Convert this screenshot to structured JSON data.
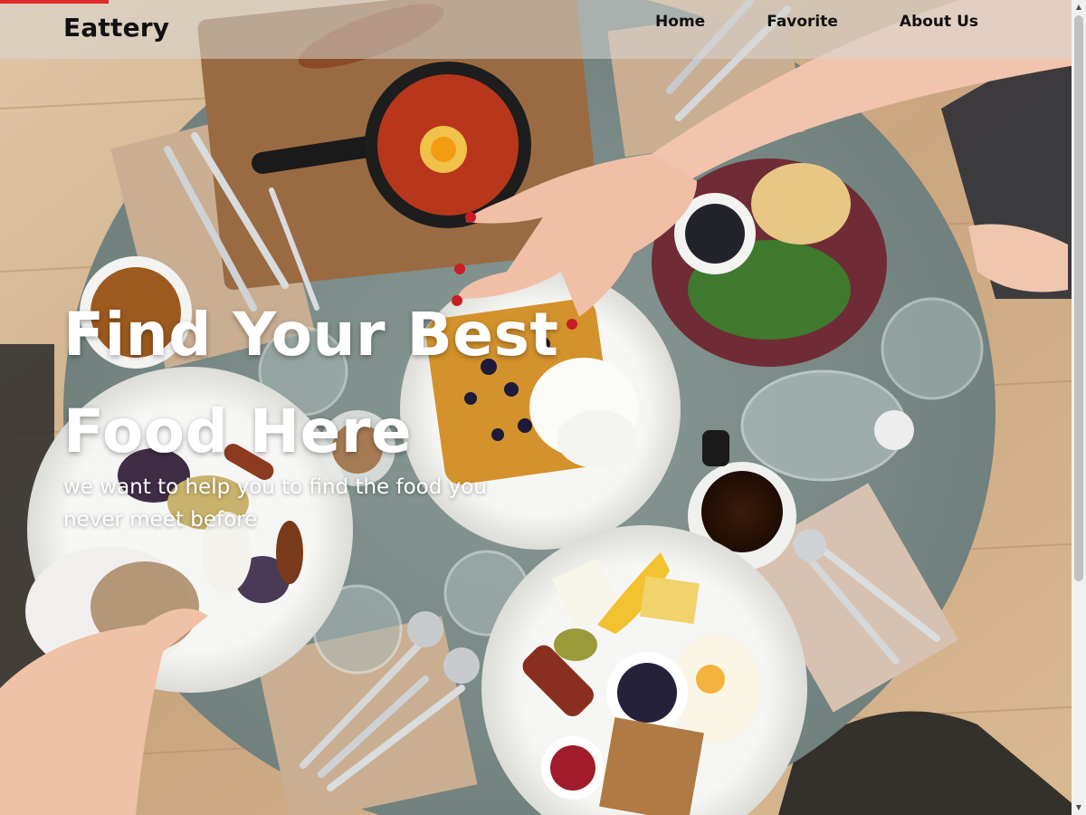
{
  "navbar": {
    "brand": "Eattery",
    "links": [
      "Home",
      "Favorite",
      "About Us"
    ]
  },
  "hero": {
    "headline_line1": "Find Your Best",
    "headline_line2": "Food Here",
    "subtitle_line1": "we want to help you to find the food you",
    "subtitle_line2": "never meet before"
  },
  "colors": {
    "accent": "#e12a2a",
    "navbar_bg": "rgba(215,215,212,0.55)",
    "table": "#7f8f8c",
    "wood_floor": "#cfae89",
    "text_light": "#ffffff",
    "text_dark": "#111111"
  },
  "icons": {
    "scroll_up": "▲",
    "scroll_down": "▼"
  }
}
